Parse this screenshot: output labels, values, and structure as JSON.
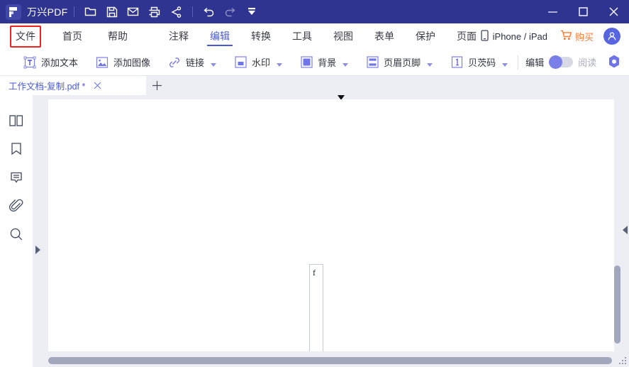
{
  "window": {
    "brand": "万兴PDF",
    "quick_actions": [
      {
        "name": "open-folder",
        "icon": "folder-icon"
      },
      {
        "name": "save",
        "icon": "save-icon"
      },
      {
        "name": "email",
        "icon": "mail-icon"
      },
      {
        "name": "print",
        "icon": "print-icon"
      },
      {
        "name": "share",
        "icon": "share-icon"
      },
      {
        "name": "undo",
        "icon": "undo-icon"
      },
      {
        "name": "redo",
        "icon": "redo-icon"
      },
      {
        "name": "more",
        "icon": "chevron-down-filled-icon"
      }
    ],
    "controls": {
      "minimize": "minimize-icon",
      "maximize": "maximize-icon",
      "close": "close-icon"
    }
  },
  "menubar": {
    "items": [
      {
        "label": "文件",
        "state": "boxed"
      },
      {
        "label": "首页",
        "state": "normal"
      },
      {
        "label": "帮助",
        "state": "normal"
      },
      {
        "label": "注释",
        "state": "normal"
      },
      {
        "label": "编辑",
        "state": "active"
      },
      {
        "label": "转换",
        "state": "normal"
      },
      {
        "label": "工具",
        "state": "normal"
      },
      {
        "label": "视图",
        "state": "normal"
      },
      {
        "label": "表单",
        "state": "normal"
      },
      {
        "label": "保护",
        "state": "normal"
      },
      {
        "label": "页面",
        "state": "normal"
      }
    ],
    "device_link": "iPhone / iPad",
    "buy_label": "购买"
  },
  "toolbar": {
    "items": [
      {
        "label": "添加文本",
        "icon": "add-text-icon",
        "dropdown": false
      },
      {
        "label": "添加图像",
        "icon": "add-image-icon",
        "dropdown": false
      },
      {
        "label": "链接",
        "icon": "link-icon",
        "dropdown": true
      },
      {
        "label": "水印",
        "icon": "watermark-icon",
        "dropdown": true
      },
      {
        "label": "背景",
        "icon": "background-icon",
        "dropdown": true
      },
      {
        "label": "页眉页脚",
        "icon": "header-footer-icon",
        "dropdown": true
      },
      {
        "label": "贝茨码",
        "icon": "bates-number-icon",
        "dropdown": true
      }
    ],
    "mode_edit": "编辑",
    "mode_read": "阅读",
    "mode_active": "编辑",
    "settings_icon": "hexagon-settings-icon"
  },
  "tabs": {
    "documents": [
      {
        "title": "工作文档-复制.pdf *",
        "active": true
      }
    ],
    "add_tab": "+"
  },
  "sidebar": {
    "items": [
      {
        "name": "thumbnails",
        "icon": "thumbnails-icon"
      },
      {
        "name": "bookmarks",
        "icon": "bookmark-icon"
      },
      {
        "name": "comments",
        "icon": "comment-icon"
      },
      {
        "name": "attachments",
        "icon": "paperclip-icon"
      },
      {
        "name": "search",
        "icon": "search-icon"
      }
    ]
  },
  "document": {
    "textbox_content": "f"
  },
  "colors": {
    "titlebar": "#2e3490",
    "accent": "#4a5bd4",
    "highlight_box": "#ee2222",
    "buy": "#ff7a33",
    "canvas": "#eceef4",
    "toggle_knob": "#7b7fe8"
  }
}
